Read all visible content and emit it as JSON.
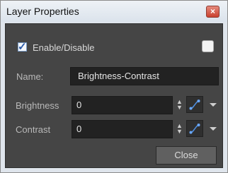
{
  "window": {
    "title": "Layer Properties",
    "close_glyph": "×",
    "close_icon": "close-icon"
  },
  "enable": {
    "label": "Enable/Disable",
    "checked": true,
    "check_glyph": "✓"
  },
  "name": {
    "label": "Name:",
    "value": "Brightness-Contrast"
  },
  "brightness": {
    "label": "Brightness",
    "value": "0",
    "spin_up": "▲",
    "spin_down": "▼"
  },
  "contrast": {
    "label": "Contrast",
    "value": "0",
    "spin_up": "▲",
    "spin_down": "▼"
  },
  "buttons": {
    "close": "Close"
  },
  "colors": {
    "panel": "#454545",
    "field": "#222222",
    "accent": "#3d7fd6"
  }
}
